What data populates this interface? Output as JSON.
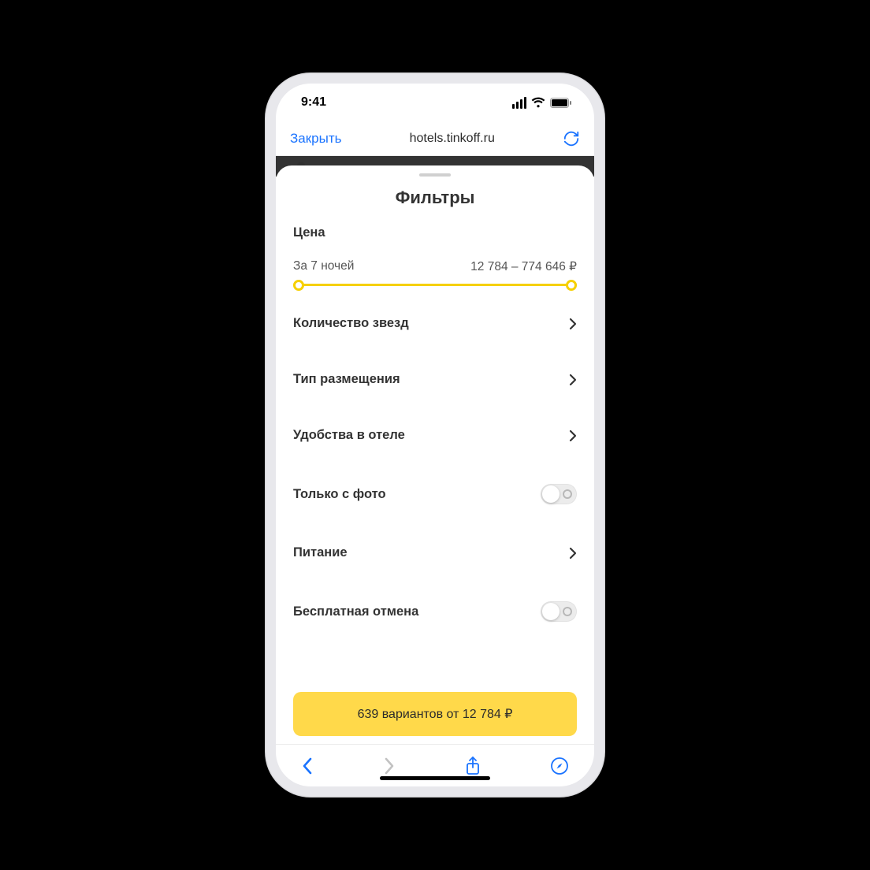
{
  "status": {
    "time": "9:41"
  },
  "browser": {
    "close_label": "Закрыть",
    "url": "hotels.tinkoff.ru"
  },
  "sheet": {
    "title": "Фильтры",
    "price": {
      "label": "Цена",
      "nights_label": "За 7 ночей",
      "range_label": "12 784 – 774 646 ₽"
    },
    "filters": {
      "stars": "Количество звезд",
      "accommodation_type": "Тип размещения",
      "hotel_amenities": "Удобства в отеле",
      "only_with_photo": "Только с фото",
      "meals": "Питание",
      "free_cancel": "Бесплатная отмена"
    },
    "cta_label": "639 вариантов от 12 784 ₽"
  }
}
